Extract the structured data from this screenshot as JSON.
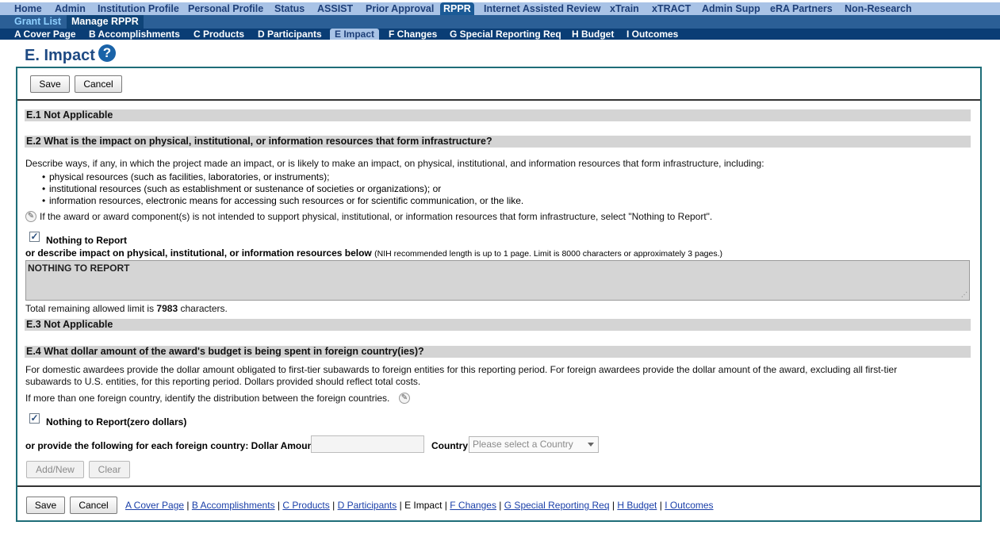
{
  "nav_top": [
    "Home",
    "Admin",
    "Institution Profile",
    "Personal Profile",
    "Status",
    "ASSIST",
    "Prior Approval",
    "RPPR",
    "Internet Assisted Review",
    "xTrain",
    "xTRACT",
    "Admin Supp",
    "eRA Partners",
    "Non-Research"
  ],
  "nav_mid": [
    "Grant List",
    "Manage RPPR"
  ],
  "nav_sections": [
    "A Cover Page",
    "B Accomplishments",
    "C Products",
    "D Participants",
    "E Impact",
    "F Changes",
    "G Special Reporting Req",
    "H Budget",
    "I Outcomes"
  ],
  "page": {
    "title": "E. Impact",
    "help": "?"
  },
  "buttons": {
    "save": "Save",
    "cancel": "Cancel",
    "add_new": "Add/New",
    "clear": "Clear"
  },
  "e1": {
    "heading": "E.1 Not Applicable"
  },
  "e2": {
    "heading": "E.2 What is the impact on physical, institutional, or information resources that form infrastructure?",
    "intro": "Describe ways, if any, in which the project made an impact, or is likely to make an impact, on physical, institutional, and information resources that form infrastructure, including:",
    "bullets": [
      "physical resources (such as facilities, laboratories, or instruments);",
      "institutional resources (such as establishment or sustenance of societies or organizations); or",
      "information resources, electronic means for accessing such resources or for scientific communication, or the like."
    ],
    "note": "If the award or award component(s) is not intended to support physical, institutional, or information resources that form infrastructure, select \"Nothing to Report\".",
    "nothing_label": "Nothing to Report",
    "describe_label": "or describe impact on physical, institutional, or information resources below",
    "describe_hint": "(NIH recommended length is up to 1 page. Limit is 8000 characters or approximately 3 pages.)",
    "textarea_value": "NOTHING TO REPORT",
    "remaining_prefix": "Total remaining allowed limit is",
    "remaining_count": "7983",
    "remaining_suffix": "characters."
  },
  "e3": {
    "heading": "E.3 Not Applicable"
  },
  "e4": {
    "heading": "E.4 What dollar amount of the award's budget is being spent in foreign country(ies)?",
    "desc_line1": "For domestic awardees provide the dollar amount obligated to first-tier subawards to foreign entities for this reporting period. For foreign awardees provide the dollar amount of the award, excluding all first-tier",
    "desc_line2": "subawards to U.S. entities, for this reporting period. Dollars provided should reflect total costs.",
    "distribution": "If more than one foreign country, identify the distribution between the foreign countries.",
    "nothing_label": "Nothing to Report(zero dollars)",
    "provide_label": "or provide the following for each foreign country: Dollar Amount",
    "dollar_value": "",
    "country_label": "Country",
    "country_placeholder": "Please select a Country"
  },
  "footer": {
    "links": [
      "A Cover Page",
      "B Accomplishments",
      "C Products",
      "D Participants",
      "E Impact",
      "F Changes",
      "G Special Reporting Req",
      "H Budget",
      "I Outcomes"
    ],
    "sep": "|"
  }
}
